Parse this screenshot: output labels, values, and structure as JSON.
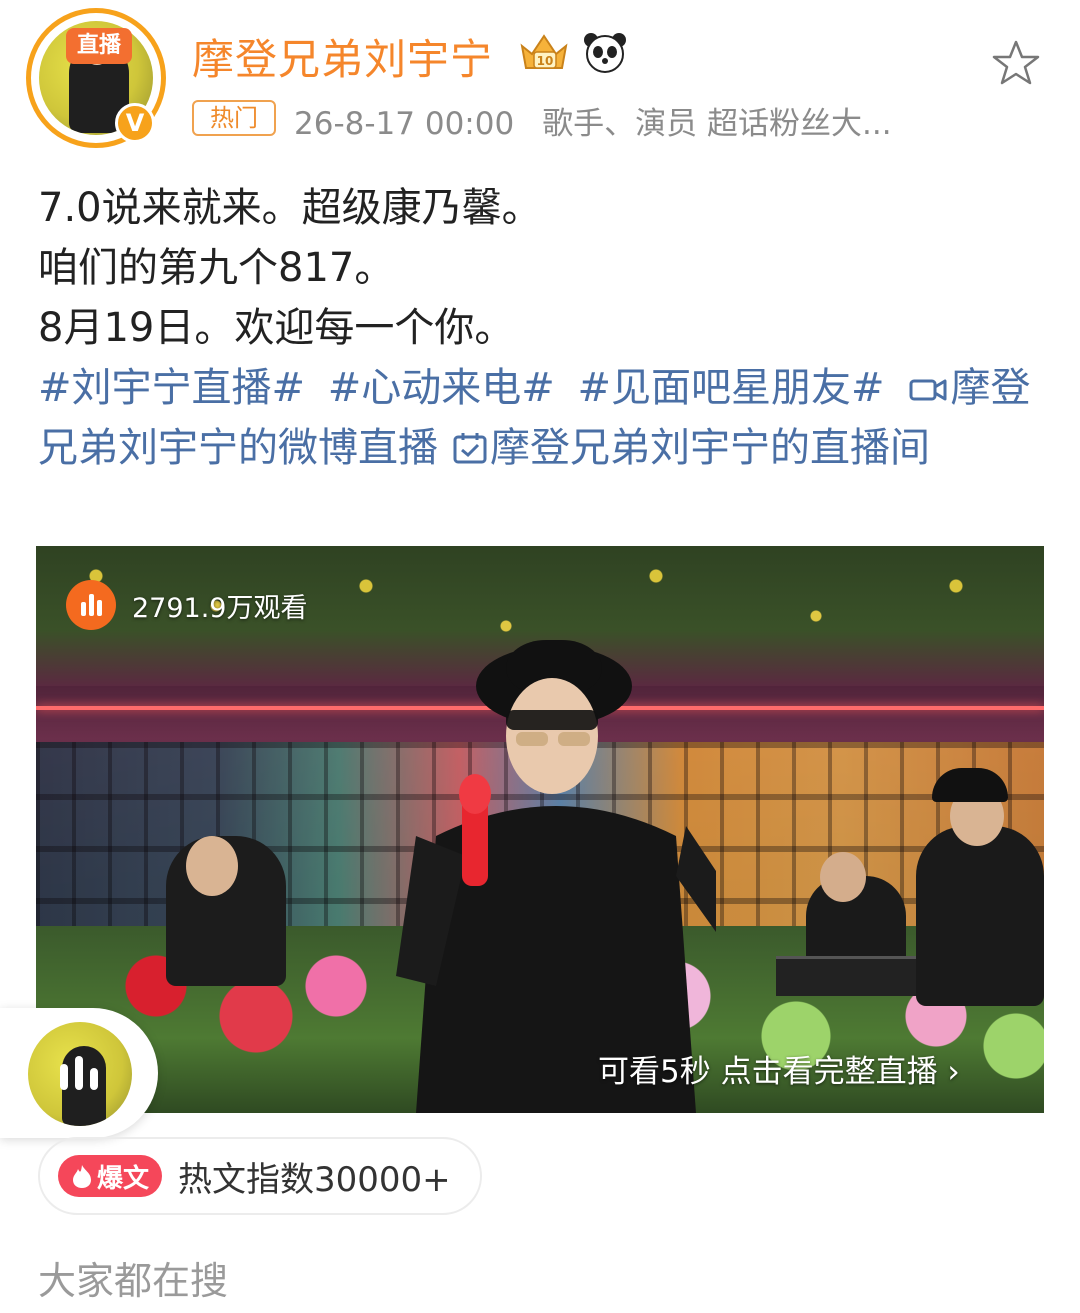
{
  "header": {
    "avatar_live_label": "直播",
    "verified_label": "V",
    "username": "摩登兄弟刘宇宁",
    "badge_crown_label": "10",
    "hot_label": "热门",
    "time": "26-8-17 00:00",
    "bio": "歌手、演员 超话粉丝大..."
  },
  "post": {
    "lines": [
      "7.0说来就来。超级康乃馨。",
      "咱们的第九个817。",
      "8月19日。欢迎每一个你。"
    ],
    "topics": [
      "#刘宇宁直播#",
      "#心动来电#",
      "#见面吧星朋友#"
    ],
    "link_live": "摩登兄弟刘宇宁的微博直播",
    "link_room": "摩登兄弟刘宇宁的直播间"
  },
  "video": {
    "views": "2791.9万观看",
    "preview_hint": "可看5秒 点击看完整直播 ›"
  },
  "hot_index": {
    "badge": "爆文",
    "text": "热文指数30000+"
  },
  "section": {
    "search_title": "大家都在搜"
  },
  "colors": {
    "username": "#f5862b",
    "topic_link": "#4a6fa5",
    "meta_gray": "#8b8b8b",
    "live_orange": "#f46a1f",
    "fire_red": "#f5475a"
  },
  "icons": [
    "crown-icon",
    "panda-icon",
    "star-icon",
    "video-camera-icon",
    "live-room-icon",
    "views-bars-icon",
    "fire-icon",
    "audio-bars-icon"
  ]
}
